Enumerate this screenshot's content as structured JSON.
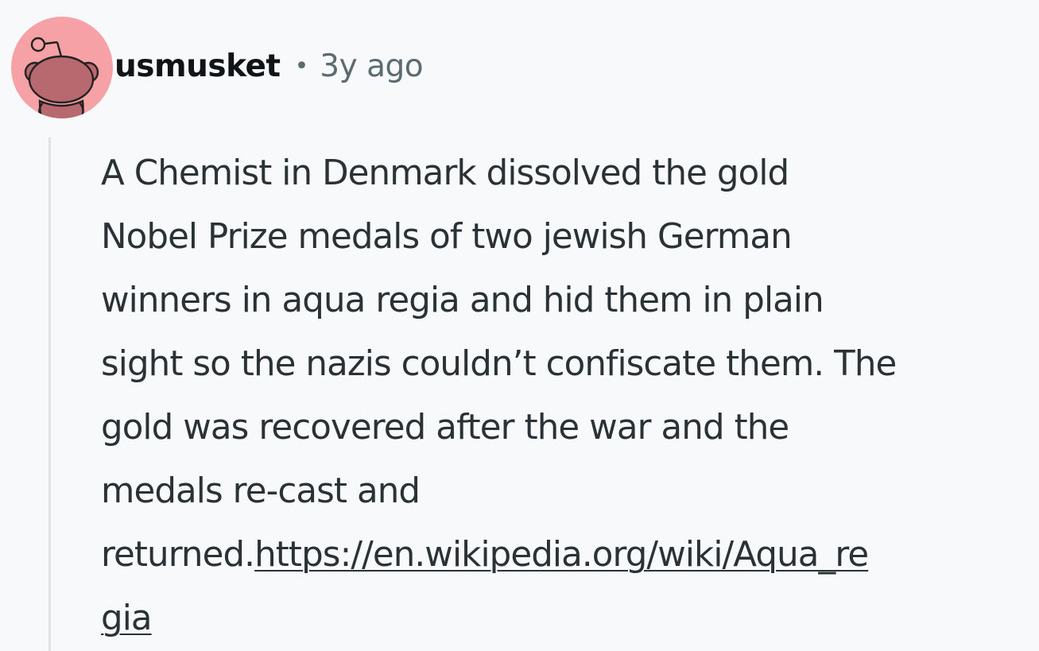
{
  "comment": {
    "author": "usmusket",
    "separator": "•",
    "age": "3y ago",
    "avatar_icon": "snoo-avatar-icon",
    "avatar_color": "#f5a1a6",
    "text_lines": [
      "A Chemist in Denmark dissolved the gold",
      "Nobel Prize medals of two jewish German",
      "winners in aqua regia and hid them in plain",
      "sight so the nazis couldn’t confiscate them. The",
      "gold was recovered after the war and the",
      "medals re-cast and"
    ],
    "text_tail": "returned.",
    "link_line1": "https://en.wikipedia.org/wiki/Aqua_re",
    "link_line2": "gia"
  }
}
